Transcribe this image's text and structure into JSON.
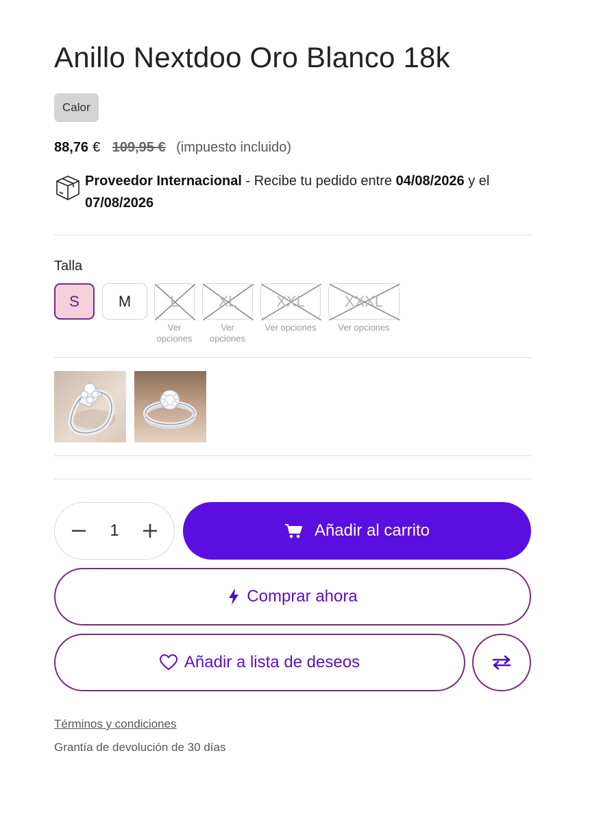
{
  "product": {
    "title": "Anillo Nextdoo Oro Blanco 18k",
    "badge": "Calor",
    "price_now": "88,76",
    "currency": "€",
    "price_old": "109,95 €",
    "tax_note": "(impuesto incluido)"
  },
  "shipping": {
    "icon": "package-box-icon",
    "provider": "Proveedor Internacional",
    "text_before": " - Recibe tu pedido entre ",
    "date_from": "04/08/2026",
    "text_middle": " y el ",
    "date_to": "07/08/2026"
  },
  "size": {
    "label": "Talla",
    "options": [
      {
        "label": "S",
        "selected": true,
        "available": true
      },
      {
        "label": "M",
        "selected": false,
        "available": true
      },
      {
        "label": "L",
        "selected": false,
        "available": false,
        "note": "Ver opciones"
      },
      {
        "label": "XL",
        "selected": false,
        "available": false,
        "note": "Ver opciones"
      },
      {
        "label": "XXL",
        "selected": false,
        "available": false,
        "note": "Ver opciones"
      },
      {
        "label": "XXXL",
        "selected": false,
        "available": false,
        "note": "Ver opciones"
      }
    ]
  },
  "gallery": {
    "thumbs": [
      "ring-image-1",
      "ring-image-2"
    ]
  },
  "cart": {
    "quantity": "1",
    "minus_icon": "minus-icon",
    "plus_icon": "plus-icon",
    "add_label": "Añadir al carrito",
    "cart_icon": "cart-icon"
  },
  "buy_now": {
    "label": "Comprar ahora",
    "icon": "lightning-icon"
  },
  "wishlist": {
    "label": "Añadir a lista de deseos",
    "icon": "heart-icon",
    "compare_icon": "compare-arrows-icon"
  },
  "footer": {
    "terms": "Términos y condiciones",
    "guarantee": "Grantía de devolución de 30 días"
  },
  "colors": {
    "primary": "#5a0fe0",
    "outline": "#7b2b78",
    "selected_bg": "#f5d0da"
  }
}
